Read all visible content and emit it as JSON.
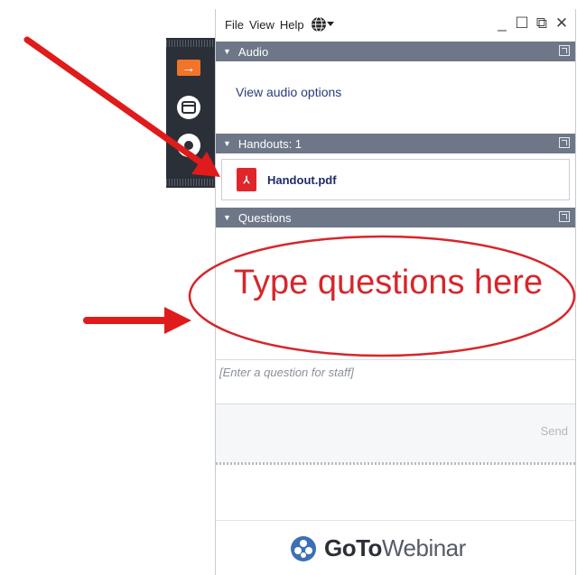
{
  "menubar": {
    "items": [
      "File",
      "View",
      "Help"
    ],
    "globe_icon": "globe-icon",
    "window_controls": [
      "minimize-icon",
      "maximize-icon",
      "restore-icon",
      "close-icon"
    ]
  },
  "audio": {
    "header": "Audio",
    "link": "View audio options"
  },
  "handouts": {
    "header": "Handouts: 1",
    "file": {
      "name": "Handout.pdf",
      "icon": "pdf-icon"
    }
  },
  "questions": {
    "header": "Questions",
    "placeholder": "[Enter a question for staff]",
    "send_label": "Send"
  },
  "annotation": {
    "callout_text": "Type questions here",
    "color": "#d7262b"
  },
  "footer": {
    "brand_bold": "GoTo",
    "brand_light": "Webinar"
  },
  "colors": {
    "header_bg": "#6e7788",
    "strip_bg": "#2b2f38",
    "accent_orange": "#f0742a",
    "pdf_red": "#e0262b"
  }
}
